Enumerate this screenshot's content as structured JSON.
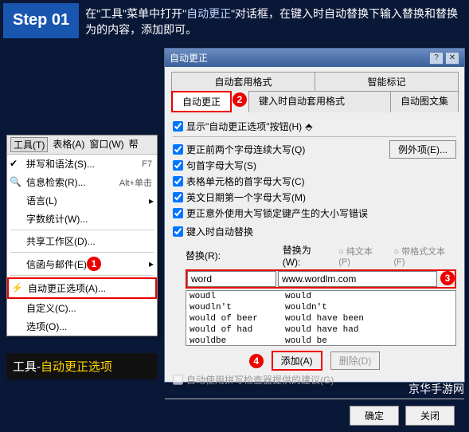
{
  "step": {
    "badge": "Step 01",
    "instruction_prefix": "在\"工具\"菜单中打开\"",
    "instruction_hl": "自动更正",
    "instruction_suffix": "\"对话框，在键入时自动替换下输入替换和替换为的内容，添加即可。"
  },
  "menubar": {
    "tools": "工具(T)",
    "table": "表格(A)",
    "window": "窗口(W)",
    "help": "帮"
  },
  "menu": {
    "spelling": "拼写和语法(S)...",
    "spelling_acc": "F7",
    "research": "信息检索(R)...",
    "research_acc": "Alt+单击",
    "language": "语言(L)",
    "wordcount": "字数统计(W)...",
    "sharedws": "共享工作区(D)...",
    "letters": "信函与邮件(E)",
    "autocorrect": "自动更正选项(A)...",
    "customize": "自定义(C)...",
    "options": "选项(O)..."
  },
  "badges": {
    "b1": "1",
    "b2": "2",
    "b3": "3",
    "b4": "4"
  },
  "caption": {
    "prefix": "工具-",
    "hl": "自动更正选项"
  },
  "dialog": {
    "title": "自动更正",
    "tabs": {
      "autoformat": "自动套用格式",
      "autocorrect": "自动更正",
      "asyoutype": "键入时自动套用格式",
      "smarttags": "智能标记",
      "autotext": "自动图文集"
    },
    "show_btn": "显示\"自动更正选项\"按钮(H)",
    "exceptions": "例外项(E)...",
    "chk1": "更正前两个字母连续大写(Q)",
    "chk2": "句首字母大写(S)",
    "chk3": "表格单元格的首字母大写(C)",
    "chk4": "英文日期第一个字母大写(M)",
    "chk5": "更正意外使用大写锁定键产生的大小写错误",
    "chk6": "键入时自动替换",
    "replace_lbl": "替换(R):",
    "replacewith_lbl": "替换为(W):",
    "radio_plain": "纯文本(P)",
    "radio_fmt": "带格式文本(F)",
    "input_replace": "word",
    "input_with": "www.wordlm.com",
    "list": [
      {
        "k": "woudl",
        "v": "would"
      },
      {
        "k": "woudln't",
        "v": "wouldn't"
      },
      {
        "k": "would of beer",
        "v": "would have been"
      },
      {
        "k": "would of had",
        "v": "would have had"
      },
      {
        "k": "wouldbe",
        "v": "would be"
      }
    ],
    "add": "添加(A)",
    "delete": "删除(D)",
    "spellcheck_sugg": "自动使用拼写检查器提供的建议(G)",
    "ok": "确定",
    "cancel": "关闭"
  },
  "source": "京华手游网"
}
